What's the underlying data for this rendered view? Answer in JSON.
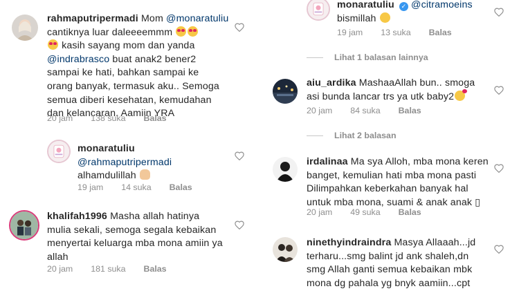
{
  "left": {
    "comment1": {
      "username": "rahmaputripermadi",
      "text_a": "Mom ",
      "mention1": "@monaratuliu",
      "line2": "cantiknya luar daleeeemmm ",
      "line3": " kasih sayang mom dan yanda",
      "mention2": "@indrabrasco",
      "text_b": " buat anak2 bener2",
      "line5": "sampai ke hati, bahkan sampai ke",
      "line6": "orang banyak, termasuk aku.. Semoga",
      "line7": "semua diberi kesehatan, kemudahan",
      "line8": "dan kelancaran. Aamiin YRA",
      "time": "20 jam",
      "likes": "138 suka",
      "reply": "Balas"
    },
    "reply1": {
      "username": "monaratuliu",
      "mention": "@rahmaputripermadi",
      "text": "alhamdulillah ",
      "time": "19 jam",
      "likes": "14 suka",
      "reply": "Balas"
    },
    "comment2": {
      "username": "khalifah1996",
      "line1": " Masha allah hatinya",
      "line2": "mulia sekali, semoga segala kebaikan",
      "line3": "menyertai keluarga mba mona amiin ya",
      "line4": "allah",
      "time": "20 jam",
      "likes": "181 suka",
      "reply": "Balas"
    }
  },
  "right": {
    "reply0": {
      "username": "monaratuliu",
      "mention": "@citramoeins",
      "text": "bismillah ",
      "time": "19 jam",
      "likes": "13 suka",
      "reply": "Balas"
    },
    "view_more_1": "Lihat 1 balasan lainnya",
    "comment1": {
      "username": "aiu_ardika",
      "line1": " MashaaAllah bun.. smoga",
      "line2": "asi bunda lancar trs ya utk baby2",
      "time": "20 jam",
      "likes": "84 suka",
      "reply": "Balas"
    },
    "view_more_2": "Lihat 2 balasan",
    "comment2": {
      "username": "irdalinaa",
      "line1": " Ma sya Alloh, mba mona keren",
      "line2": "banget, kemulian hati mba mona pasti",
      "line3": "Dilimpahkan keberkahan banyak hal",
      "line4": "untuk mba mona, suami & anak anak ▯",
      "time": "20 jam",
      "likes": "49 suka",
      "reply": "Balas"
    },
    "comment3": {
      "username": "ninethyindraindra",
      "line1": " Masya Allaaah...jd",
      "line2": "terharu...smg balint jd ank shaleh,dn",
      "line3": "smg Allah ganti semua kebaikan mbk",
      "line4": "mona dg pahala yg bnyk aamiin...cpt"
    }
  },
  "colors": {
    "text": "#262626",
    "meta": "#8e8e8e",
    "mention": "#00376b",
    "verified": "#3897f0"
  }
}
